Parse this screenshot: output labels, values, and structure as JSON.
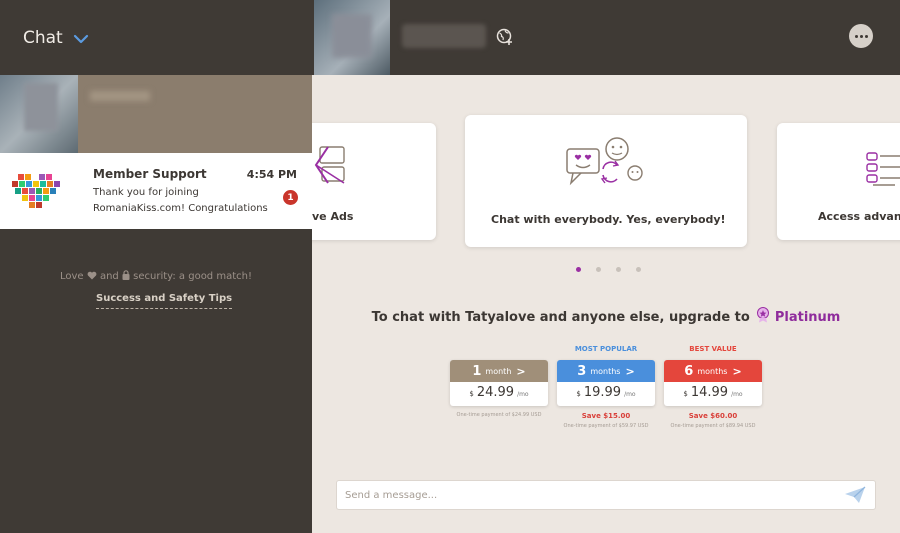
{
  "sidebar": {
    "title": "Chat",
    "support": {
      "name": "Member Support",
      "time": "4:54 PM",
      "message": "Thank you for joining RomaniaKiss.com! Congratulations",
      "unread": "1"
    },
    "tagline_love": "Love",
    "tagline_and": "and",
    "tagline_rest": "security: a good match!",
    "tips_link": "Success and Safety Tips"
  },
  "features": {
    "left_label": "ve Ads",
    "center_label": "Chat with everybody. Yes, everybody!",
    "right_label": "Access advance"
  },
  "upgrade": {
    "text": "To chat with Tatyalove and anyone else, upgrade to",
    "tier": "Platinum"
  },
  "plans": [
    {
      "num": "1",
      "unit": "month",
      "currency": "$",
      "price": "24.99",
      "per": "/mo",
      "tag": "",
      "save": "",
      "note": "One-time payment of $24.99 USD",
      "color": "#a08f79"
    },
    {
      "num": "3",
      "unit": "months",
      "currency": "$",
      "price": "19.99",
      "per": "/mo",
      "tag": "MOST POPULAR",
      "save": "Save $15.00",
      "note": "One-time payment of $59.97 USD",
      "color": "#4a8fdc"
    },
    {
      "num": "6",
      "unit": "months",
      "currency": "$",
      "price": "14.99",
      "per": "/mo",
      "tag": "BEST VALUE",
      "save": "Save $60.00",
      "note": "One-time payment of $89.94 USD",
      "color": "#e4463c"
    }
  ],
  "message_input": {
    "placeholder": "Send a message..."
  },
  "colors": {
    "accent": "#9a2fa3",
    "sidebar_bg": "#3f3a35",
    "main_bg": "#ede7e1"
  }
}
